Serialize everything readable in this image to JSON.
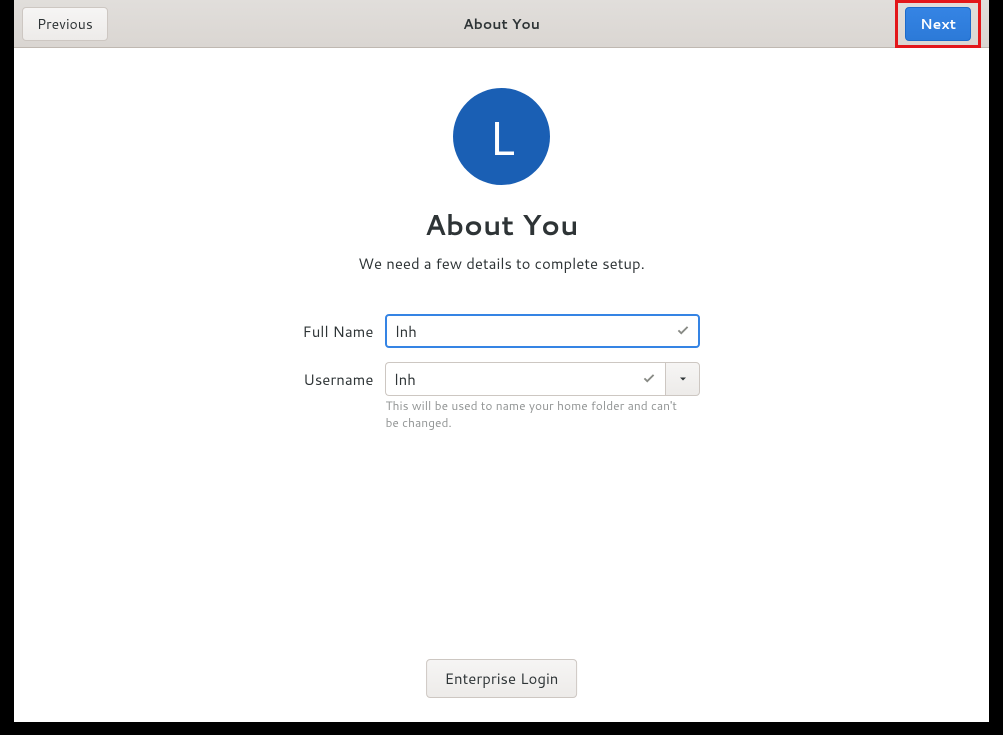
{
  "titlebar": {
    "title": "About You",
    "previous_label": "Previous",
    "next_label": "Next"
  },
  "avatar": {
    "initial": "L"
  },
  "heading": "About You",
  "subheading": "We need a few details to complete setup.",
  "form": {
    "fullname_label": "Full Name",
    "fullname_value": "lnh",
    "username_label": "Username",
    "username_value": "lnh",
    "username_helper": "This will be used to name your home folder and can't be changed."
  },
  "enterprise_login_label": "Enterprise Login"
}
